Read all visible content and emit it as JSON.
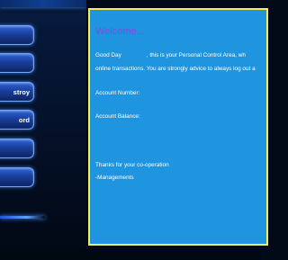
{
  "sidebar": {
    "buttons": [
      {
        "label": ""
      },
      {
        "label": ""
      },
      {
        "label": "stroy"
      },
      {
        "label": "ord"
      },
      {
        "label": ""
      },
      {
        "label": ""
      }
    ]
  },
  "content": {
    "welcome_title": "Welcome...",
    "greeting_start": "Good Day",
    "greeting_rest": ", this is your Personal Control Area, wh",
    "advice_line": "online transactions. You are strongly advice to always log out a",
    "account_number_label": "Account Number:",
    "account_balance_label": "Account Balance:",
    "thanks_line": "Thanks for your co-operation",
    "signature_line": "-Managements"
  },
  "colors": {
    "panel_background": "#1e95de",
    "panel_border": "#f4ef5a",
    "welcome_text": "#7a4ee6",
    "sidebar_background": "#041027",
    "button_gradient_top": "#2e63d6"
  }
}
